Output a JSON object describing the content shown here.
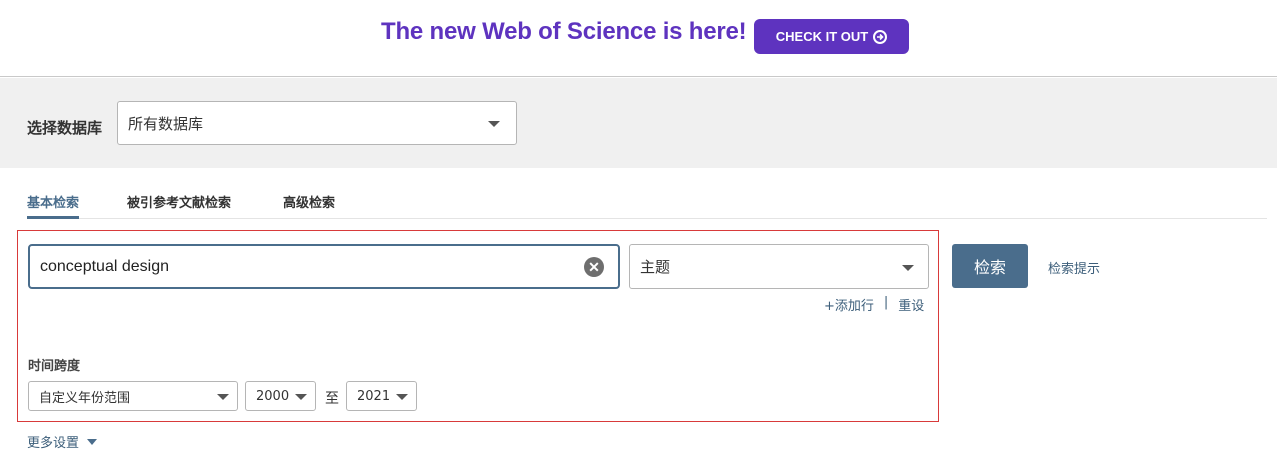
{
  "banner": {
    "headline": "The new Web of Science is here!",
    "cta_label": "CHECK IT OUT",
    "accent_color": "#5e33bf"
  },
  "database": {
    "label": "选择数据库",
    "selected": "所有数据库"
  },
  "tabs": [
    {
      "label": "基本检索",
      "active": true
    },
    {
      "label": "被引参考文献检索",
      "active": false
    },
    {
      "label": "高级检索",
      "active": false
    }
  ],
  "search": {
    "query": "conceptual design",
    "field": "主题",
    "add_row": "+添加行",
    "separator": "|",
    "reset": "重设",
    "button": "检索",
    "tips": "检索提示"
  },
  "timespan": {
    "label": "时间跨度",
    "mode": "自定义年份范围",
    "from_year": "2000",
    "to_label": "至",
    "to_year": "2021"
  },
  "more_settings": "更多设置",
  "colors": {
    "primary": "#4a6d8c",
    "highlight_border": "#d83a3a",
    "link": "#3c5e7a"
  }
}
